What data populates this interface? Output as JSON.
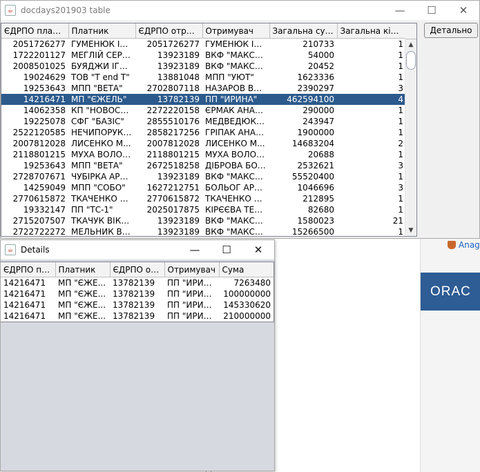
{
  "main_window": {
    "title": "docdays201903 table",
    "controls": {
      "minimize": "—",
      "maximize": "☐",
      "close": "✕"
    },
    "columns": [
      "ЄДРПО платн...",
      "Платник",
      "ЄДРПО отри...",
      "Отримувач",
      "Загальна сума",
      "Загальна кіл..."
    ],
    "rows": [
      [
        "2051726277",
        "ГУМЕНЮК ІВ...",
        "2051726277",
        "ГУМЕНЮК ІВ...",
        "210733",
        "1"
      ],
      [
        "1722201127",
        "МЕГЛІЙ СЕРГ...",
        "13923189",
        "ВКФ \"МАКС\" М...",
        "54000",
        "1"
      ],
      [
        "2008501025",
        "БУЯДЖИ ІГО...",
        "13923189",
        "ВКФ \"МАКС\" М...",
        "20452",
        "1"
      ],
      [
        "19024629",
        "ТОВ \"T end T\"",
        "13881048",
        "МПП \"УЮТ\"",
        "1623336",
        "1"
      ],
      [
        "19253643",
        "МПП \"ВЕТА\"",
        "2702807118",
        "НАЗАРОВ ВА...",
        "2390297",
        "3"
      ],
      [
        "14216471",
        "МП \"ЄЖЕЛЬ\"",
        "13782139",
        "ПП \"ИРИНА\"",
        "462594100",
        "4"
      ],
      [
        "14062358",
        "КП \"НОВОСЕЛ\"",
        "2272220158",
        "ЄРМАК АНАТ...",
        "290000",
        "1"
      ],
      [
        "19225078",
        "СФГ \"БАЗІС\"",
        "2855510176",
        "МЕДВЕДЮК А...",
        "243947",
        "1"
      ],
      [
        "2522120585",
        "НЕЧИПОРУК ...",
        "2858217256",
        "ГРІПАК АНАТ...",
        "1900000",
        "1"
      ],
      [
        "2007812028",
        "ЛИСЕНКО М...",
        "2007812028",
        "ЛИСЕНКО М...",
        "14683204",
        "2"
      ],
      [
        "2118801215",
        "МУХА ВОЛОД...",
        "2118801215",
        "МУХА ВОЛОД...",
        "20688",
        "1"
      ],
      [
        "19253643",
        "МПП \"ВЕТА\"",
        "2672518258",
        "ДІБРОВА БОР...",
        "2532621",
        "3"
      ],
      [
        "2728707671",
        "ЧУБІРКА АРТ...",
        "13923189",
        "ВКФ \"МАКС\" М...",
        "55520400",
        "1"
      ],
      [
        "14259049",
        "МПП \"СОБО\"",
        "1627212751",
        "БОЛЬОГ АРП...",
        "1046696",
        "3"
      ],
      [
        "2770615872",
        "ТКАЧЕНКО К...",
        "2770615872",
        "ТКАЧЕНКО К...",
        "212895",
        "1"
      ],
      [
        "19332147",
        "ПП \"ТС-1\"",
        "2025017875",
        "КІРЄЄВА ТЕТ...",
        "82680",
        "1"
      ],
      [
        "2715207507",
        "ТКАЧУК ВІКТ...",
        "13923189",
        "ВКФ \"МАКС\" М...",
        "1580023",
        "21"
      ],
      [
        "2722722272",
        "МЕЛЬНИК ВА...",
        "13923189",
        "ВКФ \"МАКС\" М...",
        "15266500",
        "1"
      ]
    ],
    "selected_row": 5,
    "detail_button": "Детально"
  },
  "details_window": {
    "title": "Details",
    "controls": {
      "minimize": "—",
      "maximize": "☐",
      "close": "✕"
    },
    "columns": [
      "ЄДРПО пл...",
      "Платник",
      "ЄДРПО от...",
      "Отримувач",
      "Сума"
    ],
    "rows": [
      [
        "14216471",
        "МП \"ЄЖЕ...",
        "13782139",
        "ПП \"ИРИН...",
        "7263480"
      ],
      [
        "14216471",
        "МП \"ЄЖЕ...",
        "13782139",
        "ПП \"ИРИН...",
        "100000000"
      ],
      [
        "14216471",
        "МП \"ЄЖЕ...",
        "13782139",
        "ПП \"ИРИН...",
        "145330620"
      ],
      [
        "14216471",
        "МП \"ЄЖЕ...",
        "13782139",
        "ПП \"ИРИН...",
        "210000000"
      ]
    ]
  },
  "background": {
    "link_text": "Anag",
    "banner_text": "ORAC"
  },
  "colors": {
    "selection": "#2c5a8c",
    "banner": "#2e5c94"
  }
}
